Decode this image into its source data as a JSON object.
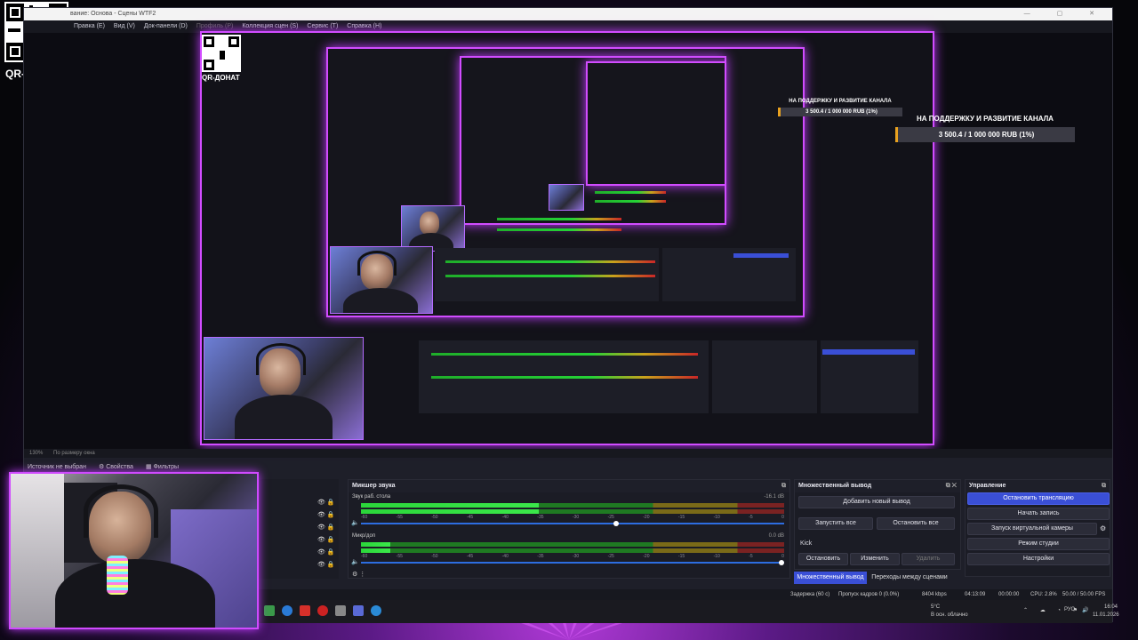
{
  "overlay": {
    "qr_label": "QR-ДОНАТ",
    "donation_title": "НА ПОДДЕРЖКУ И РАЗВИТИЕ КАНАЛА",
    "donation_amount": "3 500.4 / 1 000 000 RUB (1%)",
    "donation_progress_percent": 1
  },
  "window": {
    "title": "вание: Основа - Сцены WTF2",
    "menu": [
      "Правка (E)",
      "Вид (V)",
      "Док-панели (D)",
      "Профиль (P)",
      "Коллекция сцен (S)",
      "Сервис (T)",
      "Справка (H)"
    ]
  },
  "preview": {
    "zoom": "130%",
    "fit_label": "По размеру окна"
  },
  "sources": {
    "none_selected": "Источник не выбран",
    "properties": "Свойства",
    "filters": "Фильтры"
  },
  "mixer": {
    "title": "Микшер звука",
    "ticks": [
      "-60",
      "-55",
      "-50",
      "-45",
      "-40",
      "-35",
      "-30",
      "-25",
      "-20",
      "-15",
      "-10",
      "-5",
      "0"
    ],
    "channels": [
      {
        "name": "Звук раб. стола",
        "db": "-16.1 dB",
        "level": 0.42,
        "volume": 0.61
      },
      {
        "name": "Микр/доп",
        "db": "0.0 dB",
        "level": 0.07,
        "volume": 1.0
      }
    ]
  },
  "multi_output": {
    "title": "Множественный вывод",
    "add_new": "Добавить новый вывод",
    "start_all": "Запустить все",
    "stop_all": "Остановить все",
    "target": "Kick",
    "stop": "Остановить",
    "edit": "Изменить",
    "delete": "Удалить"
  },
  "control": {
    "title": "Управление",
    "stop_stream": "Остановить трансляцию",
    "start_record": "Начать запись",
    "virtual_cam": "Запуск виртуальной камеры",
    "studio_mode": "Режим студии",
    "settings": "Настройки"
  },
  "bottom_tabs": {
    "multi_output": "Множественный вывод",
    "transitions": "Переходы между сценами"
  },
  "status": {
    "delay": "Задержка (60 с)",
    "dropped": "Пропуск кадров 0 (0.0%)",
    "bitrate": "8404 kbps",
    "stream_time": "04:13:09",
    "rec_time": "00:00:00",
    "cpu": "CPU: 2.8%",
    "fps": "50.00 / 50.00 FPS"
  },
  "taskbar": {
    "weather": "5°C",
    "weather_desc": "В осн. облачно",
    "lang": "РУС",
    "time": "16:04",
    "date": "11.01.2026"
  }
}
